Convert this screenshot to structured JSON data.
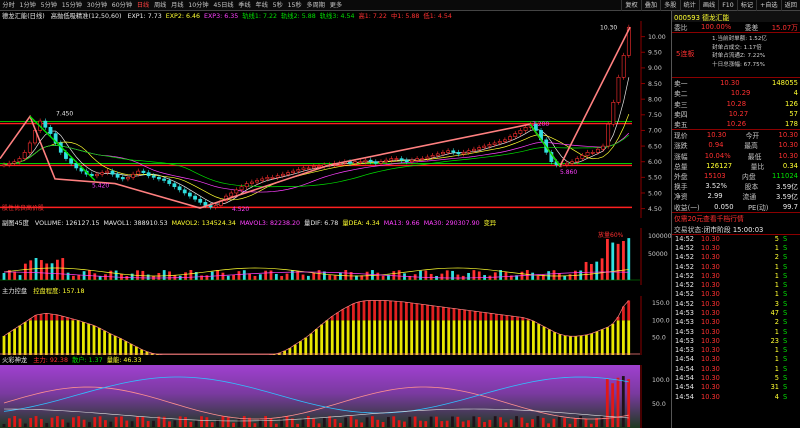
{
  "tabbar": {
    "periods": [
      "分时",
      "1分钟",
      "5分钟",
      "15分钟",
      "30分钟",
      "60分钟",
      "日线",
      "周线",
      "月线",
      "10分钟",
      "45日线",
      "季线",
      "年线",
      "5秒",
      "15秒",
      "多周期",
      "更多"
    ],
    "active_index": 6,
    "right_buttons": [
      "复权",
      "叠加",
      "多股",
      "统计",
      "画线",
      "F10",
      "标记",
      "+自选",
      "返回"
    ]
  },
  "main_info": {
    "period": "德龙汇能(日线)",
    "indicator": "高抛低吸精准(12,50,60)",
    "items": [
      {
        "label": "EXP1: 7.73",
        "color": "#e8e8e8"
      },
      {
        "label": "EXP2: 6.46",
        "color": "#ffff30"
      },
      {
        "label": "EXP3: 6.35",
        "color": "#ff40ff"
      },
      {
        "label": "轨线1: 7.22",
        "color": "#00e000"
      },
      {
        "label": "轨线2: 5.88",
        "color": "#00e000"
      },
      {
        "label": "轨线3: 4.54",
        "color": "#00e000"
      },
      {
        "label": "高1: 7.22",
        "color": "#ff3030"
      },
      {
        "label": "中1: 5.88",
        "color": "#ff3030"
      },
      {
        "label": "低1: 4.54",
        "color": "#ff3030"
      }
    ],
    "annotations": {
      "top_label": "10.30",
      "peak1": "7.450",
      "low1": "5.420",
      "low2": "4.520",
      "mid": "5.860",
      "peak2": "7.200",
      "note": "股性优良高价股"
    },
    "price_axis": [
      "10.00",
      "9.50",
      "9.00",
      "8.50",
      "8.00",
      "7.50",
      "7.00",
      "6.50",
      "6.00",
      "5.50",
      "5.00",
      "4.50"
    ],
    "candle_closes": [
      5.9,
      5.95,
      6.0,
      6.1,
      6.3,
      6.6,
      7.0,
      7.3,
      7.1,
      6.9,
      6.6,
      6.3,
      6.1,
      5.95,
      5.8,
      5.7,
      5.6,
      5.55,
      5.6,
      5.65,
      5.7,
      5.6,
      5.5,
      5.45,
      5.5,
      5.6,
      5.7,
      5.65,
      5.55,
      5.5,
      5.45,
      5.4,
      5.3,
      5.2,
      5.1,
      5.0,
      4.9,
      4.8,
      4.7,
      4.6,
      4.55,
      4.6,
      4.75,
      4.9,
      5.0,
      5.1,
      5.2,
      5.3,
      5.35,
      5.4,
      5.45,
      5.5,
      5.5,
      5.55,
      5.6,
      5.65,
      5.7,
      5.75,
      5.8,
      5.8,
      5.85,
      5.85,
      5.9,
      5.9,
      5.95,
      5.95,
      6.0,
      5.95,
      6.0,
      6.0,
      6.05,
      6.0,
      5.95,
      6.0,
      6.05,
      6.1,
      6.1,
      6.05,
      6.0,
      6.05,
      6.1,
      6.1,
      6.15,
      6.2,
      6.25,
      6.3,
      6.35,
      6.3,
      6.25,
      6.3,
      6.35,
      6.4,
      6.45,
      6.5,
      6.55,
      6.6,
      6.65,
      6.7,
      6.8,
      6.9,
      7.0,
      7.1,
      7.2,
      7.0,
      6.7,
      6.3,
      6.0,
      5.9,
      5.9,
      5.95,
      6.0,
      6.1,
      6.2,
      6.3,
      6.3,
      6.4,
      6.5,
      7.2,
      7.9,
      8.7,
      9.4,
      10.3
    ]
  },
  "vol_info": {
    "label": "副图45度",
    "items": [
      {
        "label": "VOLUME: 126127.15",
        "color": "#e8e8e8"
      },
      {
        "label": "MAVOL1: 388910.53",
        "color": "#e8e8e8"
      },
      {
        "label": "MAVOL2: 134524.34",
        "color": "#ffff30"
      },
      {
        "label": "MAVOL3: 82238.20",
        "color": "#ff40ff"
      },
      {
        "label": "量DIF: 6.78",
        "color": "#e8e8e8"
      },
      {
        "label": "量DEA: 4.34",
        "color": "#ffff30"
      },
      {
        "label": "MA13: 9.66",
        "color": "#ff40ff"
      },
      {
        "label": "MA30: 290307.90",
        "color": "#ff40ff"
      },
      {
        "label": "变异",
        "color": "#ffff30"
      }
    ],
    "axis": [
      "100000",
      "50000"
    ],
    "tag": "放量60%"
  },
  "power_info": {
    "label": "主力控盘",
    "items": [
      {
        "label": "控盘程度: 157.18",
        "color": "#ffff30"
      }
    ],
    "axis": [
      "150.0",
      "100.0",
      "50.0"
    ],
    "values": [
      55,
      65,
      75,
      85,
      95,
      105,
      115,
      118,
      120,
      118,
      116,
      112,
      108,
      104,
      100,
      95,
      90,
      85,
      78,
      70,
      62,
      55,
      48,
      40,
      32,
      24,
      16,
      10,
      5,
      2,
      0,
      0,
      0,
      0,
      0,
      0,
      0,
      0,
      0,
      0,
      0,
      0,
      0,
      0,
      0,
      0,
      0,
      0,
      0,
      0,
      0,
      2,
      6,
      12,
      20,
      30,
      40,
      50,
      62,
      75,
      88,
      100,
      112,
      122,
      132,
      140,
      148,
      153,
      156,
      157,
      157,
      157,
      157,
      156,
      155,
      154,
      152,
      150,
      148,
      146,
      144,
      142,
      140,
      138,
      136,
      134,
      132,
      130,
      128,
      126,
      124,
      122,
      120,
      118,
      116,
      114,
      112,
      110,
      108,
      104,
      98,
      90,
      82,
      74,
      66,
      60,
      56,
      54,
      54,
      56,
      58,
      62,
      68,
      74,
      80,
      90,
      110,
      140,
      157
    ]
  },
  "color_info": {
    "label": "火彩神龙",
    "items": [
      {
        "label": "主力: 92.38",
        "color": "#ff3030"
      },
      {
        "label": "散户: 1.37",
        "color": "#00e000"
      },
      {
        "label": "量能: 46.33",
        "color": "#ffff30"
      }
    ],
    "axis": [
      "100.0",
      "50.0"
    ]
  },
  "panel": {
    "code": "000593",
    "name": "德龙汇能",
    "wei_bi_label": "委比",
    "wei_bi": "100.00%",
    "wei_cha_label": "委差",
    "wei_cha": "15.07万",
    "board": "5连板",
    "seal_lines": [
      "1.当前封单额: 1.52亿",
      "封单占成交: 1.17倍",
      "封单占流通Z: 7.22%",
      "十日总涨幅: 67.75%"
    ],
    "asks": [
      {
        "label": "卖一",
        "price": "10.30",
        "vol": "148055"
      },
      {
        "label": "卖二",
        "price": "10.29",
        "vol": "4"
      },
      {
        "label": "卖三",
        "price": "10.28",
        "vol": "126"
      },
      {
        "label": "卖四",
        "price": "10.27",
        "vol": "57"
      },
      {
        "label": "卖五",
        "price": "10.26",
        "vol": "178"
      }
    ],
    "quotes": [
      {
        "l1": "现价",
        "v1": "10.30",
        "c1": "red",
        "l2": "今开",
        "v2": "10.30",
        "c2": "red"
      },
      {
        "l1": "涨跌",
        "v1": "0.94",
        "c1": "red",
        "l2": "最高",
        "v2": "10.30",
        "c2": "red"
      },
      {
        "l1": "涨幅",
        "v1": "10.04%",
        "c1": "red",
        "l2": "最低",
        "v2": "10.30",
        "c2": "red"
      },
      {
        "l1": "总量",
        "v1": "126127",
        "c1": "yel",
        "l2": "量比",
        "v2": "0.34",
        "c2": "yel"
      },
      {
        "l1": "外盘",
        "v1": "15103",
        "c1": "red",
        "l2": "内盘",
        "v2": "111024",
        "c2": "green"
      },
      {
        "l1": "换手",
        "v1": "3.52%",
        "c1": "white",
        "l2": "股本",
        "v2": "3.59亿",
        "c2": "white"
      },
      {
        "l1": "净资",
        "v1": "2.99",
        "c1": "white",
        "l2": "流通",
        "v2": "3.59亿",
        "c2": "white"
      },
      {
        "l1": "收益(一)",
        "v1": "0.050",
        "c1": "white",
        "l2": "PE(动)",
        "v2": "99.7",
        "c2": "white"
      }
    ],
    "ad": "仅需20元查看千档行情",
    "status_label": "交易状态:",
    "status_value": "闭市阶段 15:00:03",
    "trades": [
      {
        "t": "14:52",
        "p": "10.30",
        "v": "5",
        "s": "S"
      },
      {
        "t": "14:52",
        "p": "10.30",
        "v": "1",
        "s": "S"
      },
      {
        "t": "14:52",
        "p": "10.30",
        "v": "2",
        "s": "S"
      },
      {
        "t": "14:52",
        "p": "10.30",
        "v": "1",
        "s": "S"
      },
      {
        "t": "14:52",
        "p": "10.30",
        "v": "1",
        "s": "S"
      },
      {
        "t": "14:52",
        "p": "10.30",
        "v": "1",
        "s": "S"
      },
      {
        "t": "14:52",
        "p": "10.30",
        "v": "1",
        "s": "S"
      },
      {
        "t": "14:52",
        "p": "10.30",
        "v": "3",
        "s": "S"
      },
      {
        "t": "14:53",
        "p": "10.30",
        "v": "47",
        "s": "S"
      },
      {
        "t": "14:53",
        "p": "10.30",
        "v": "2",
        "s": "S"
      },
      {
        "t": "14:53",
        "p": "10.30",
        "v": "1",
        "s": "S"
      },
      {
        "t": "14:53",
        "p": "10.30",
        "v": "23",
        "s": "S"
      },
      {
        "t": "14:53",
        "p": "10.30",
        "v": "1",
        "s": "S"
      },
      {
        "t": "14:54",
        "p": "10.30",
        "v": "1",
        "s": "S"
      },
      {
        "t": "14:54",
        "p": "10.30",
        "v": "1",
        "s": "S"
      },
      {
        "t": "14:54",
        "p": "10.30",
        "v": "5",
        "s": "S"
      },
      {
        "t": "14:54",
        "p": "10.30",
        "v": "31",
        "s": "S"
      },
      {
        "t": "14:54",
        "p": "10.30",
        "v": "4",
        "s": "S"
      }
    ]
  }
}
